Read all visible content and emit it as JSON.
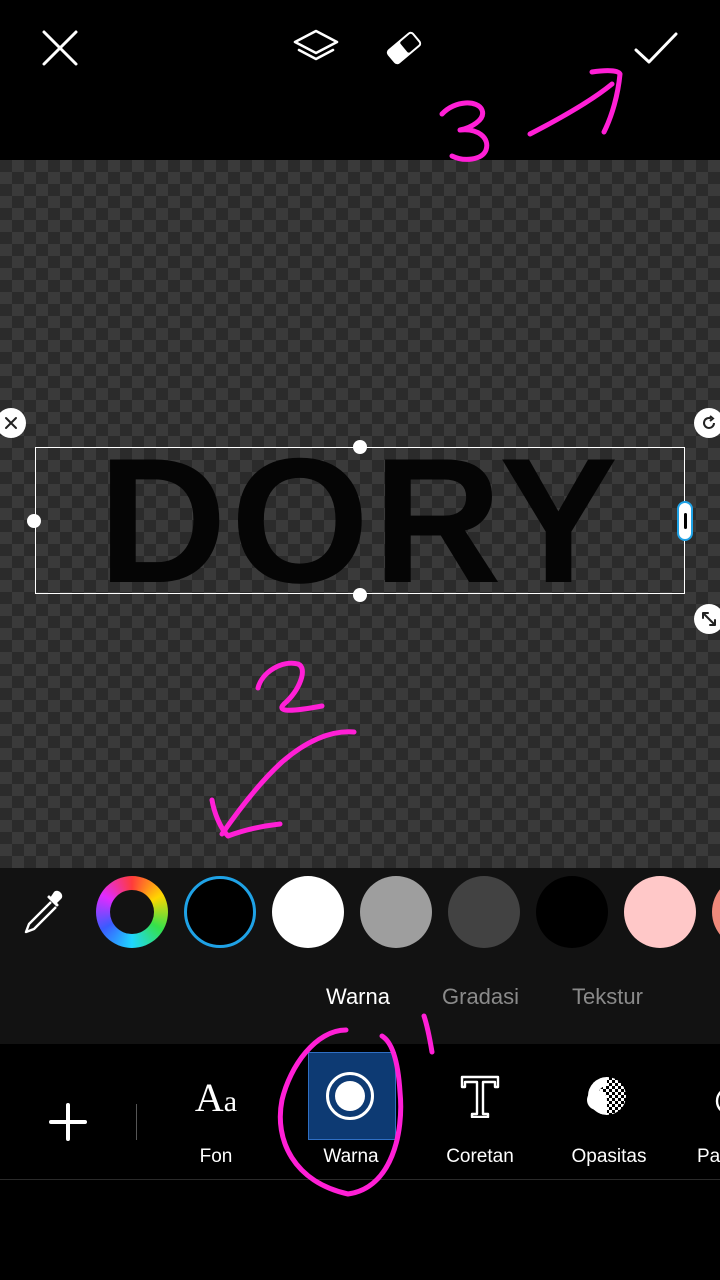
{
  "top_bar": {
    "close_icon": "close-icon",
    "layers_icon": "layers-icon",
    "eraser_icon": "eraser-icon",
    "apply_icon": "checkmark-icon"
  },
  "canvas": {
    "text": "DORY",
    "text_color": "#050505",
    "selection_color": "#ffffff",
    "handle_accent": "#1fa2e6"
  },
  "palette": {
    "eyedropper_icon": "eyedropper-icon",
    "swatches": [
      {
        "kind": "color-wheel"
      },
      {
        "color": "#000000",
        "selected": true
      },
      {
        "color": "#ffffff"
      },
      {
        "color": "#9e9e9e"
      },
      {
        "color": "#424242"
      },
      {
        "color": "#000000"
      },
      {
        "color": "#ffc8c8"
      },
      {
        "color": "#f08a7c"
      }
    ],
    "selected_ring_color": "#1fa2e6"
  },
  "color_tabs": {
    "active": "Warna",
    "inactive_1": "Gradasi",
    "inactive_2": "Tekstur"
  },
  "toolbar": {
    "add_icon": "plus-icon",
    "items": [
      {
        "label": "Fon",
        "icon": "font-icon"
      },
      {
        "label": "Warna",
        "icon": "color-icon",
        "selected": true
      },
      {
        "label": "Coretan",
        "icon": "stroke-icon"
      },
      {
        "label": "Opasitas",
        "icon": "opacity-icon"
      },
      {
        "label": "Pa",
        "icon": "partial-icon"
      }
    ],
    "selected_bg": "#0d3a73"
  },
  "annotations": {
    "color": "#ff1fd6",
    "labels": [
      "1",
      "2",
      "3"
    ]
  }
}
